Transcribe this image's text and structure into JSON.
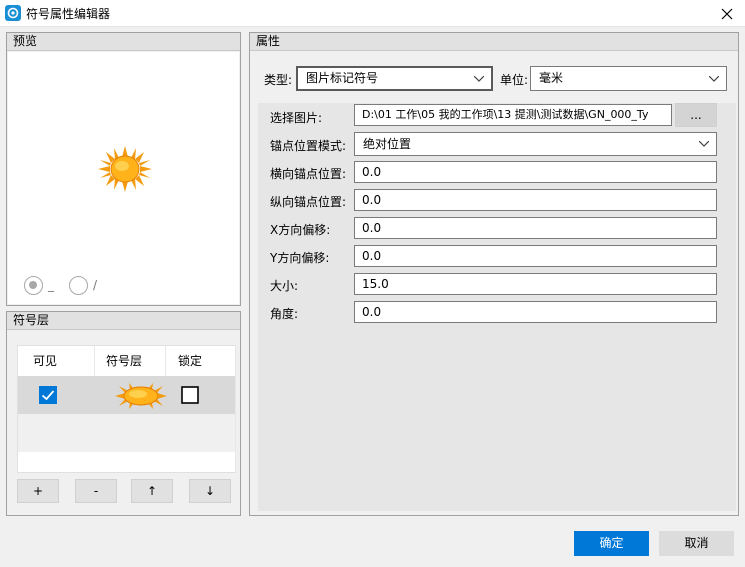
{
  "window": {
    "title": "符号属性编辑器"
  },
  "preview": {
    "header": "预览",
    "radio_options": [
      {
        "label": "_",
        "selected": true
      },
      {
        "label": "/",
        "selected": false
      }
    ]
  },
  "layers": {
    "header": "符号层",
    "columns": [
      "可见",
      "符号层",
      "锁定"
    ],
    "rows": [
      {
        "visible": true,
        "symbol_icon": "sun-icon",
        "locked": false
      }
    ],
    "buttons": [
      "+",
      "-",
      "↑",
      "↓"
    ]
  },
  "properties": {
    "header": "属性",
    "type_label": "类型:",
    "type_value": "图片标记符号",
    "unit_label": "单位:",
    "unit_value": "毫米",
    "image_label": "选择图片:",
    "image_path": "D:\\01 工作\\05 我的工作项\\13 提测\\测试数据\\GN_000_Ty",
    "browse_label": "...",
    "anchor_mode_label": "锚点位置模式:",
    "anchor_mode_value": "绝对位置",
    "h_anchor_label": "横向锚点位置:",
    "h_anchor_value": "0.0",
    "v_anchor_label": "纵向锚点位置:",
    "v_anchor_value": "0.0",
    "x_offset_label": "X方向偏移:",
    "x_offset_value": "0.0",
    "y_offset_label": "Y方向偏移:",
    "y_offset_value": "0.0",
    "size_label": "大小:",
    "size_value": "15.0",
    "angle_label": "角度:",
    "angle_value": "0.0"
  },
  "footer": {
    "ok_label": "确定",
    "cancel_label": "取消"
  },
  "colors": {
    "accent": "#0078d7",
    "checkbox_checked": "#0078d7",
    "sun": "#f5a623"
  }
}
